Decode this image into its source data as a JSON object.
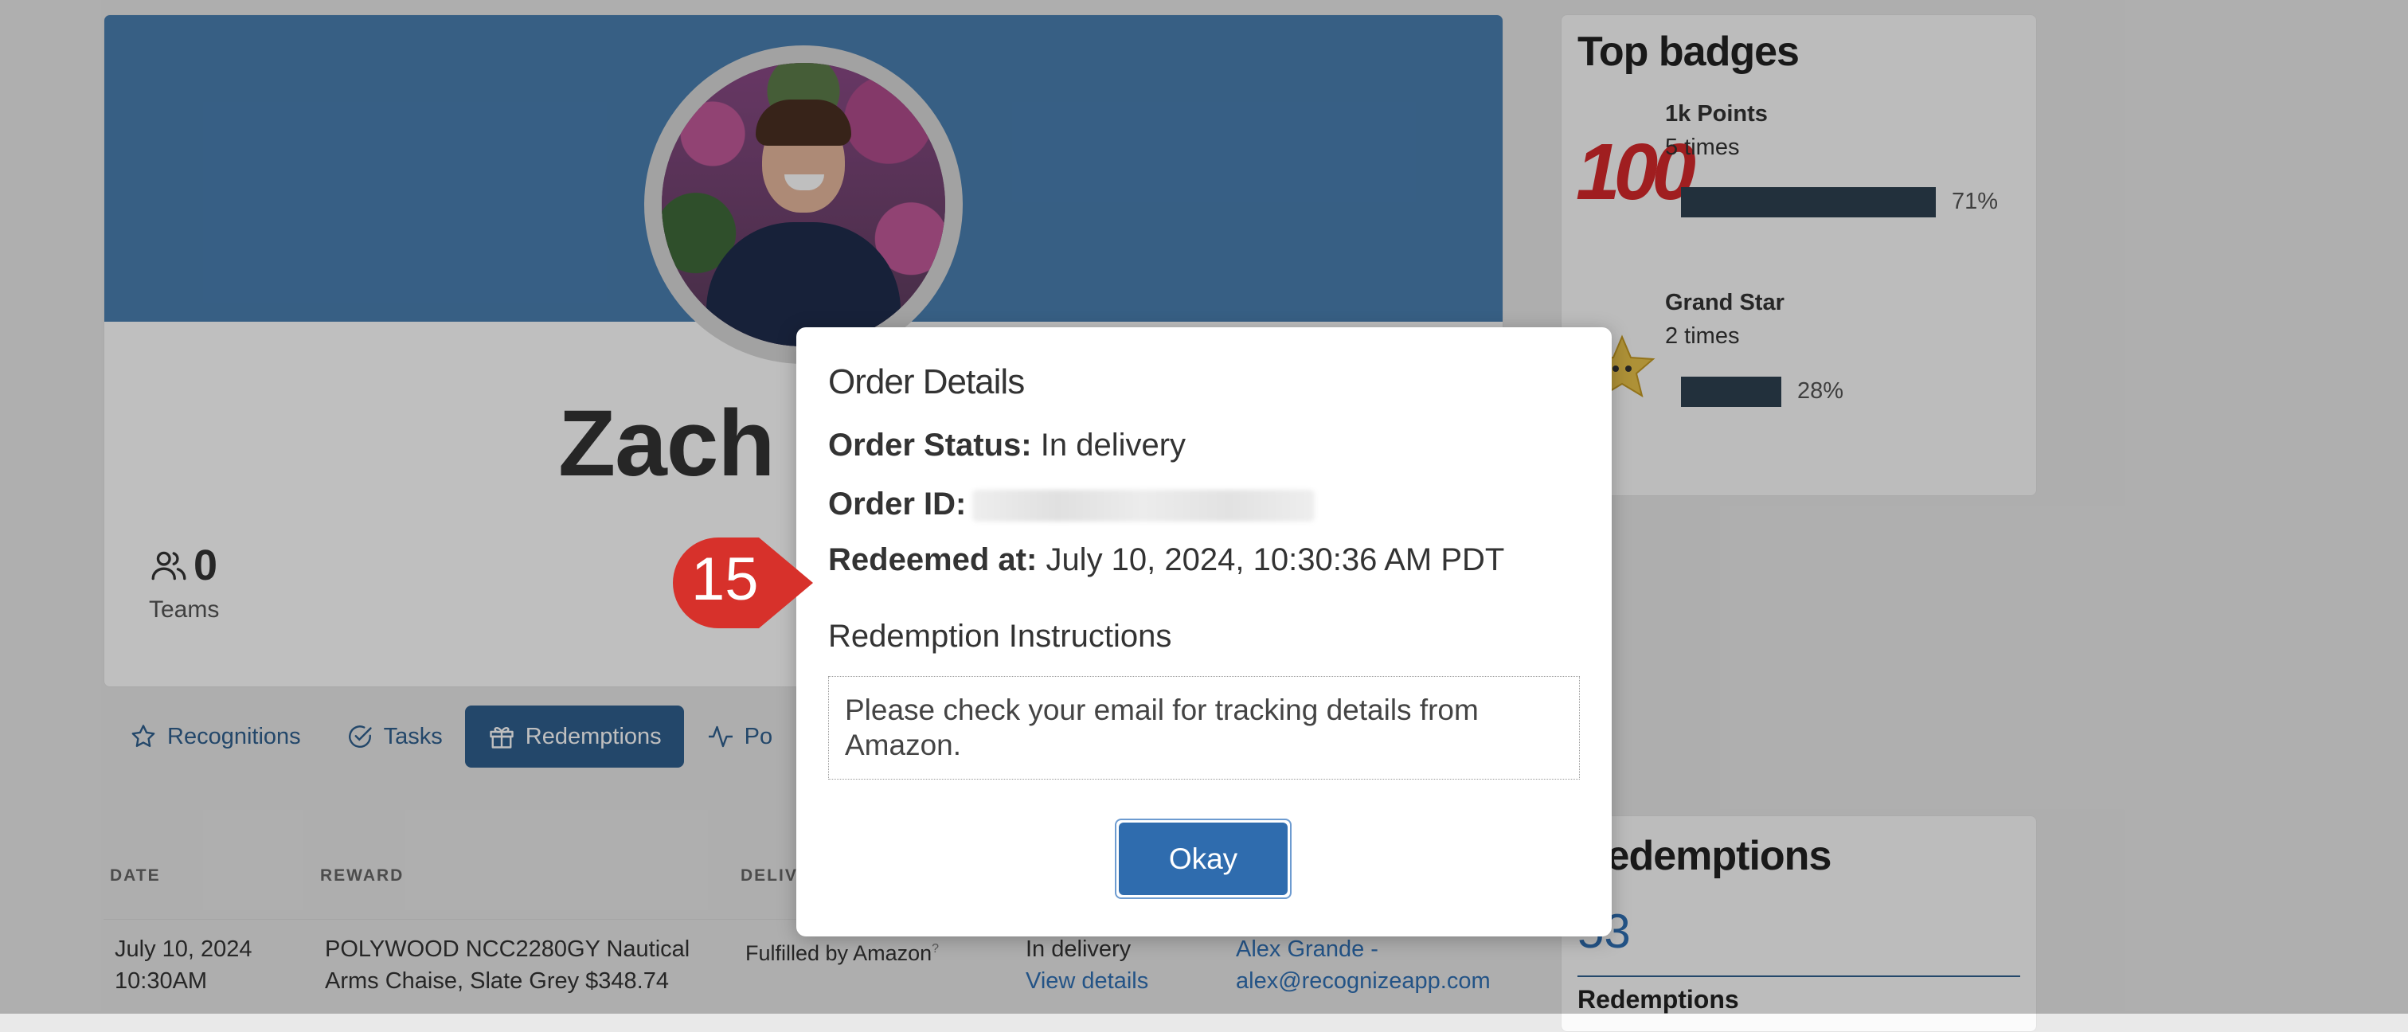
{
  "profile": {
    "name": "Zach C",
    "stat_value": "0",
    "stat_label": "Teams"
  },
  "tabs": [
    {
      "label": "Recognitions",
      "icon": "star-icon"
    },
    {
      "label": "Tasks",
      "icon": "check-circle-icon"
    },
    {
      "label": "Redemptions",
      "icon": "gift-icon",
      "active": true
    },
    {
      "label": "Po",
      "icon": "activity-icon"
    }
  ],
  "table": {
    "headers": {
      "date": "DATE",
      "reward": "REWARD",
      "delivery": "DELIV"
    },
    "row": {
      "date_line1": "July 10, 2024",
      "date_line2": "10:30AM",
      "reward_line1": "POLYWOOD NCC2280GY Nautical",
      "reward_line2": "Arms Chaise, Slate Grey $348.74",
      "delivery": "Fulfilled by Amazon",
      "delivery_sup": "?",
      "status": "In delivery",
      "status_link": "View details",
      "approver_line1": "Alex Grande -",
      "approver_line2": "alex@recognizeapp.com"
    }
  },
  "top_badges": {
    "title": "Top badges",
    "badges": [
      {
        "name": "1k Points",
        "times": "5 times",
        "percent_label": "71%",
        "fraction": 0.71,
        "icon": "hundred-points-icon",
        "icon_text": "100"
      },
      {
        "name": "Grand Star",
        "times": "2 times",
        "percent_label": "28%",
        "fraction": 0.28,
        "icon": "star-icon"
      }
    ]
  },
  "redemptions_card": {
    "title": "Redemptions",
    "count": "53",
    "subtitle": "Redemptions"
  },
  "modal": {
    "title": "Order Details",
    "status_label": "Order Status:",
    "status_value": "In delivery",
    "id_label": "Order ID:",
    "redeemed_label": "Redeemed at:",
    "redeemed_value": "July 10, 2024, 10:30:36 AM PDT",
    "instructions_title": "Redemption Instructions",
    "instructions_text": "Please check your email for tracking details from Amazon.",
    "okay_label": "Okay"
  },
  "callout": {
    "number": "15",
    "color": "#d7312b"
  },
  "colors": {
    "brand": "#2f5f8e",
    "banner": "#4a7fb1",
    "badge_bar": "#2e4150",
    "button": "#2f6cae"
  }
}
